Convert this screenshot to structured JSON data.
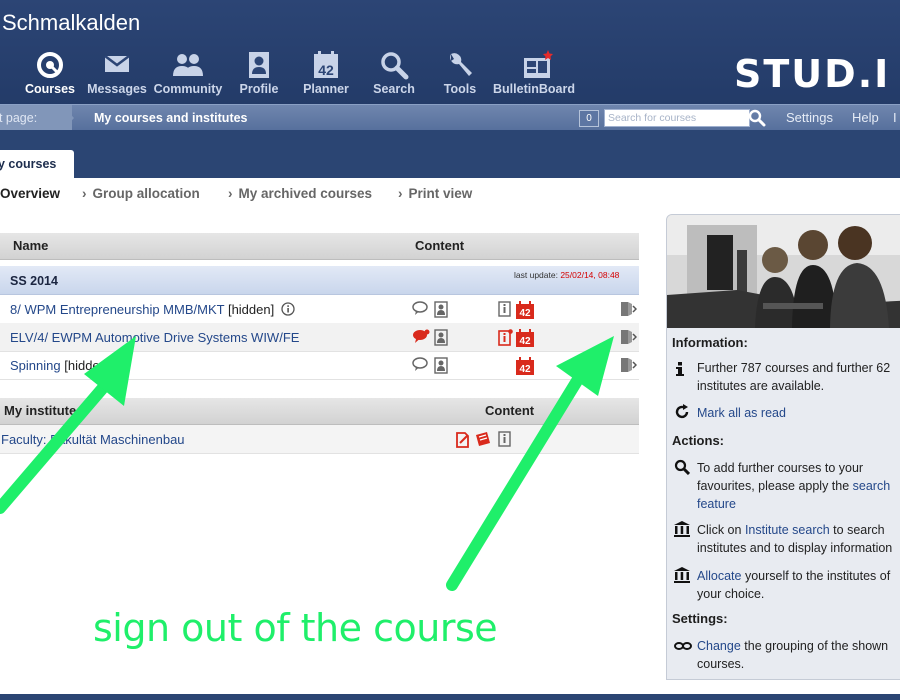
{
  "header": {
    "site_title": "Schmalkalden",
    "logo": "STUD.I",
    "nav": [
      {
        "label": "Courses",
        "icon": "courses-icon"
      },
      {
        "label": "Messages",
        "icon": "envelope-icon"
      },
      {
        "label": "Community",
        "icon": "community-icon"
      },
      {
        "label": "Profile",
        "icon": "profile-icon"
      },
      {
        "label": "Planner",
        "icon": "calendar-icon",
        "badge": "42"
      },
      {
        "label": "Search",
        "icon": "search-icon"
      },
      {
        "label": "Tools",
        "icon": "wrench-icon"
      },
      {
        "label": "BulletinBoard",
        "icon": "bulletinboard-icon"
      }
    ]
  },
  "breadcrumb": {
    "label": "nt page:",
    "current": "My courses and institutes"
  },
  "search": {
    "count": "0",
    "placeholder": "Search for courses"
  },
  "bar_links": {
    "settings": "Settings",
    "help": "Help",
    "more": "I"
  },
  "tab": {
    "label": "y courses"
  },
  "subnav": [
    "Overview",
    "Group allocation",
    "My archived courses",
    "Print view"
  ],
  "courses_table": {
    "col_name": "Name",
    "col_content": "Content",
    "semester": "SS 2014",
    "last_update_label": "last update: ",
    "last_update_date": "25/02/14, 08:48",
    "rows": [
      {
        "title": "8/ WPM Entrepreneurship MMB/MKT",
        "hidden": "[hidden]",
        "info": true
      },
      {
        "title": "ELV/4/ EWPM Automotive Drive Systems WIW/FE",
        "hidden": "",
        "info": false
      },
      {
        "title": "Spinning",
        "hidden": "[hidden]",
        "info": true
      }
    ]
  },
  "institutes_table": {
    "col_name": "My institutes",
    "col_content": "Content",
    "rows": [
      {
        "title": "Faculty: Fakultät Maschinenbau"
      }
    ]
  },
  "sidebar": {
    "information_heading": "Information:",
    "info_text": "Further 787 courses and further 62 institutes are available.",
    "mark_all": "Mark all as read",
    "actions_heading": "Actions:",
    "action1_pre": "To add further courses to your favourites, please apply the ",
    "action1_link": "search feature",
    "action2_pre": "Click on ",
    "action2_link": "Institute search",
    "action2_post": " to search institutes and to display information",
    "action3_link": "Allocate",
    "action3_post": " yourself to the institutes of your choice.",
    "settings_heading": "Settings:",
    "settings_link": "Change",
    "settings_post": " the grouping of the shown courses."
  },
  "annotation": {
    "text": "sign out of the course",
    "color": "#1fef6a"
  },
  "colors": {
    "header": "#2c4575",
    "bar": "#5d76a3",
    "link": "#24488a",
    "icon_red": "#d92a1c"
  }
}
